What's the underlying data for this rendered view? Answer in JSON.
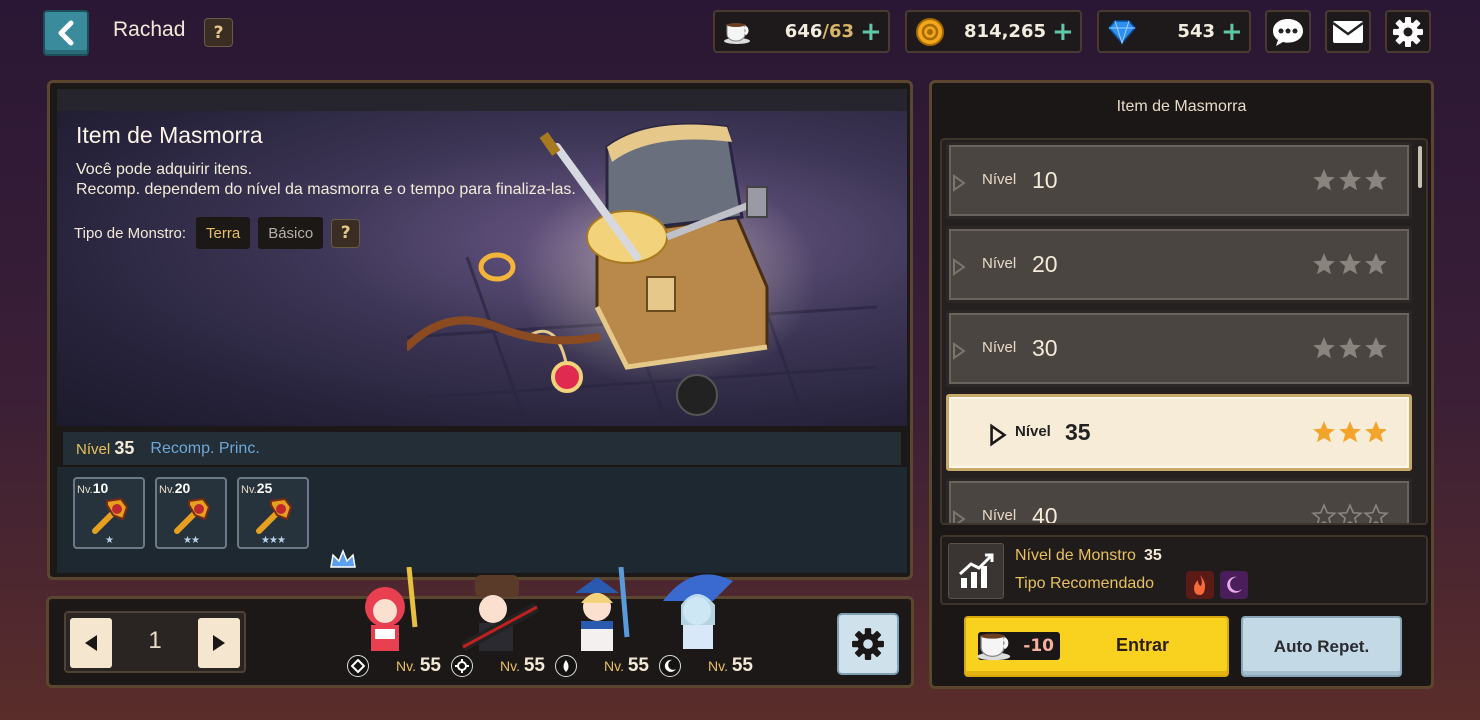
{
  "header": {
    "player_name": "Rachad",
    "help": "?",
    "resources": [
      {
        "name": "stamina",
        "icon": "coffee-cup-icon",
        "value": "646",
        "max": "/63"
      },
      {
        "name": "gold",
        "icon": "gold-coin-icon",
        "value": "814,265"
      },
      {
        "name": "gems",
        "icon": "diamond-icon",
        "value": "543"
      }
    ],
    "plus": "+"
  },
  "banner": {
    "title": "Item de Masmorra",
    "description": "Você pode adquirir itens.\nRecomp. dependem do nível da masmorra e o tempo para finaliza-las.",
    "monster_type_label": "Tipo de Monstro:",
    "tags": [
      "Terra",
      "Básico"
    ],
    "help": "?"
  },
  "rewards": {
    "level_label": "Nível",
    "level_value": "35",
    "section_label": "Recomp. Princ.",
    "items": [
      {
        "nv_label": "Nv.",
        "level": "10",
        "stars": "★"
      },
      {
        "nv_label": "Nv.",
        "level": "20",
        "stars": "★★"
      },
      {
        "nv_label": "Nv.",
        "level": "25",
        "stars": "★★★"
      }
    ]
  },
  "party": {
    "page": "1",
    "heroes": [
      {
        "nv_label": "Nv.",
        "level": "55",
        "element_icon": "diamond-element-icon",
        "leader": true
      },
      {
        "nv_label": "Nv.",
        "level": "55",
        "element_icon": "gear-element-icon",
        "leader": false
      },
      {
        "nv_label": "Nv.",
        "level": "55",
        "element_icon": "water-drop-element-icon",
        "leader": false
      },
      {
        "nv_label": "Nv.",
        "level": "55",
        "element_icon": "moon-element-icon",
        "leader": false
      }
    ]
  },
  "right_panel": {
    "title": "Item de Masmorra",
    "levels": [
      {
        "label": "Nível",
        "value": "10",
        "stars_filled": 0,
        "selected": false
      },
      {
        "label": "Nível",
        "value": "20",
        "stars_filled": 0,
        "selected": false
      },
      {
        "label": "Nível",
        "value": "30",
        "stars_filled": 0,
        "selected": false
      },
      {
        "label": "Nível",
        "value": "35",
        "stars_filled": 3,
        "selected": true
      },
      {
        "label": "Nível",
        "value": "40",
        "stars_filled": 0,
        "selected": false
      }
    ],
    "monster_level_label": "Nível de Monstro",
    "monster_level_value": "35",
    "recommended_label": "Tipo Recomendado",
    "enter": {
      "cost": "-10",
      "label": "Entrar"
    },
    "auto_repeat": "Auto Repet."
  },
  "colors": {
    "accent_gold": "#e8c060",
    "enter_yellow": "#f9d21f",
    "selected_bg": "#f6ecd8",
    "star_filled": "#f2a52a",
    "star_empty": "#8a847e"
  }
}
